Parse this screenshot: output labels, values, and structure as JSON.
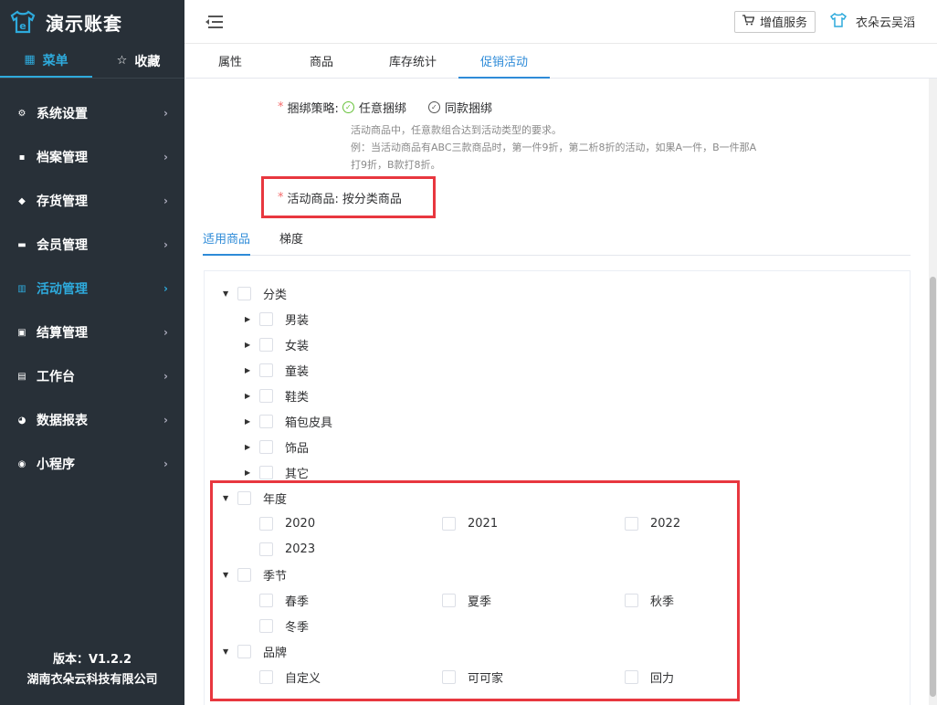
{
  "sidebar": {
    "brand": "演示账套",
    "tabs": [
      {
        "label": "菜单",
        "icon": "grid-icon"
      },
      {
        "label": "收藏",
        "icon": "star-icon"
      }
    ],
    "items": [
      {
        "label": "系统设置"
      },
      {
        "label": "档案管理"
      },
      {
        "label": "存货管理"
      },
      {
        "label": "会员管理"
      },
      {
        "label": "活动管理"
      },
      {
        "label": "结算管理"
      },
      {
        "label": "工作台"
      },
      {
        "label": "数据报表"
      },
      {
        "label": "小程序"
      }
    ],
    "version": "版本：V1.2.2",
    "company": "湖南衣朵云科技有限公司"
  },
  "topbar": {
    "value_added_service": "增值服务",
    "user": "衣朵云吴滔"
  },
  "page_tabs": [
    "属性",
    "商品",
    "库存统计",
    "促销活动"
  ],
  "form": {
    "bundle_label": "捆绑策略:",
    "bundle_options": [
      "任意捆绑",
      "同款捆绑"
    ],
    "hint_lines": [
      "活动商品中，任意款组合达到活动类型的要求。",
      "例：当活动商品有ABC三款商品时，第一件9折，第二析8折的活动，如果A一件，B一件那A",
      "打9折，B款打8折。"
    ],
    "activity_goods_label": "活动商品:",
    "activity_goods_value": "按分类商品"
  },
  "sub_tabs": [
    "适用商品",
    "梯度"
  ],
  "tree": {
    "category": {
      "label": "分类",
      "children": [
        "男装",
        "女装",
        "童装",
        "鞋类",
        "箱包皮具",
        "饰品",
        "其它"
      ]
    },
    "year": {
      "label": "年度",
      "children": [
        "2020",
        "2021",
        "2022",
        "2023"
      ]
    },
    "season": {
      "label": "季节",
      "children": [
        "春季",
        "夏季",
        "秋季",
        "冬季"
      ]
    },
    "brand": {
      "label": "品牌",
      "children": [
        "自定义",
        "可可家",
        "回力"
      ]
    }
  },
  "colors": {
    "sidebar_bg": "#283038",
    "accent": "#2eaadc",
    "link": "#2e8bd8",
    "highlight_box": "#e8373f",
    "radio_selected": "#67c23a"
  }
}
